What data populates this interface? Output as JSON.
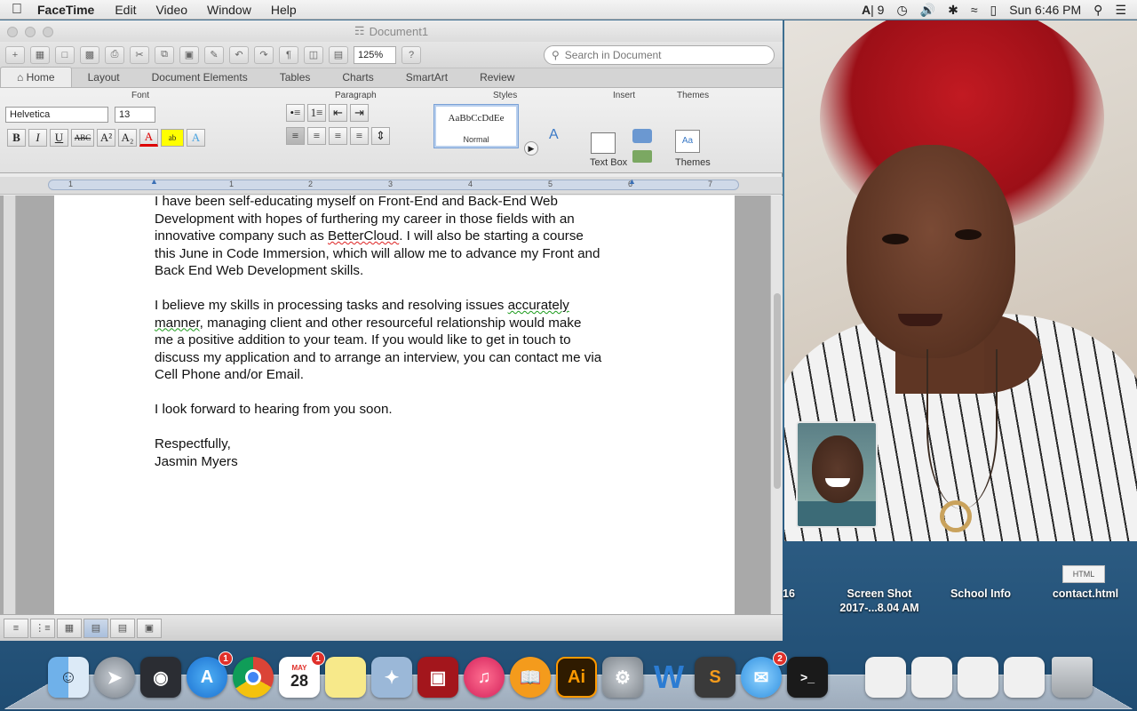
{
  "menubar": {
    "app": "FaceTime",
    "items": [
      "Edit",
      "Video",
      "Window",
      "Help"
    ],
    "status": {
      "adobe_count": "9",
      "clock": "Sun 6:46 PM"
    }
  },
  "word": {
    "title": "Document1",
    "zoom": "125%",
    "search_placeholder": "Search in Document",
    "tabs": [
      "Home",
      "Layout",
      "Document Elements",
      "Tables",
      "Charts",
      "SmartArt",
      "Review"
    ],
    "ribbon": {
      "font_group": "Font",
      "paragraph_group": "Paragraph",
      "styles_group": "Styles",
      "insert_group": "Insert",
      "themes_group": "Themes",
      "font_name": "Helvetica",
      "font_size": "13",
      "style_sample": "AaBbCcDdEe",
      "style_name": "Normal",
      "textbox_label": "Text Box",
      "themes_label": "Themes",
      "bold": "B",
      "italic": "I",
      "underline": "U",
      "strike": "ABC"
    },
    "ruler_marks": [
      "1",
      "1",
      "2",
      "3",
      "4",
      "5",
      "6",
      "7"
    ],
    "document": {
      "para1_line1": "I have been self-educating myself on Front-End and Back-End Web",
      "para1_line2": "Development with hopes of furthering my career in those fields with an",
      "para1_line3a": "innovative company such as ",
      "para1_bettercloud": "BetterCloud",
      "para1_line3b": ". I will also be starting a course",
      "para1_line4": "this June in Code Immersion, which will allow me to advance my Front and",
      "para1_line5": "Back End Web Development skills.",
      "para2_line1a": "I believe my skills in processing tasks and resolving issues ",
      "para2_accurately": "accurately",
      "para2_manner": "manner",
      "para2_line2b": ", managing client and other resourceful relationship would make",
      "para2_line3": "me a positive addition to your team. If you would like to get in touch to",
      "para2_line4": "discuss my application and to arrange an interview, you can contact me via",
      "para2_line5": "Cell Phone and/or Email.",
      "para3": "I look forward to hearing from you soon.",
      "closing": "Respectfully,",
      "signature": "Jasmin Myers"
    }
  },
  "desktop": {
    "icon1_label": "16",
    "icon2_label": "Screen Shot",
    "icon2_sub": "2017-...8.04 AM",
    "icon3_label": "School Info",
    "icon4_label": "contact.html",
    "icon4_file": "HTML"
  },
  "dock": {
    "appstore_badge": "1",
    "calendar_day": "28",
    "calendar_month": "MAY",
    "calendar_badge": "1",
    "messages_badge": "2",
    "illustrator": "Ai",
    "sublime": "S",
    "word": "W"
  }
}
